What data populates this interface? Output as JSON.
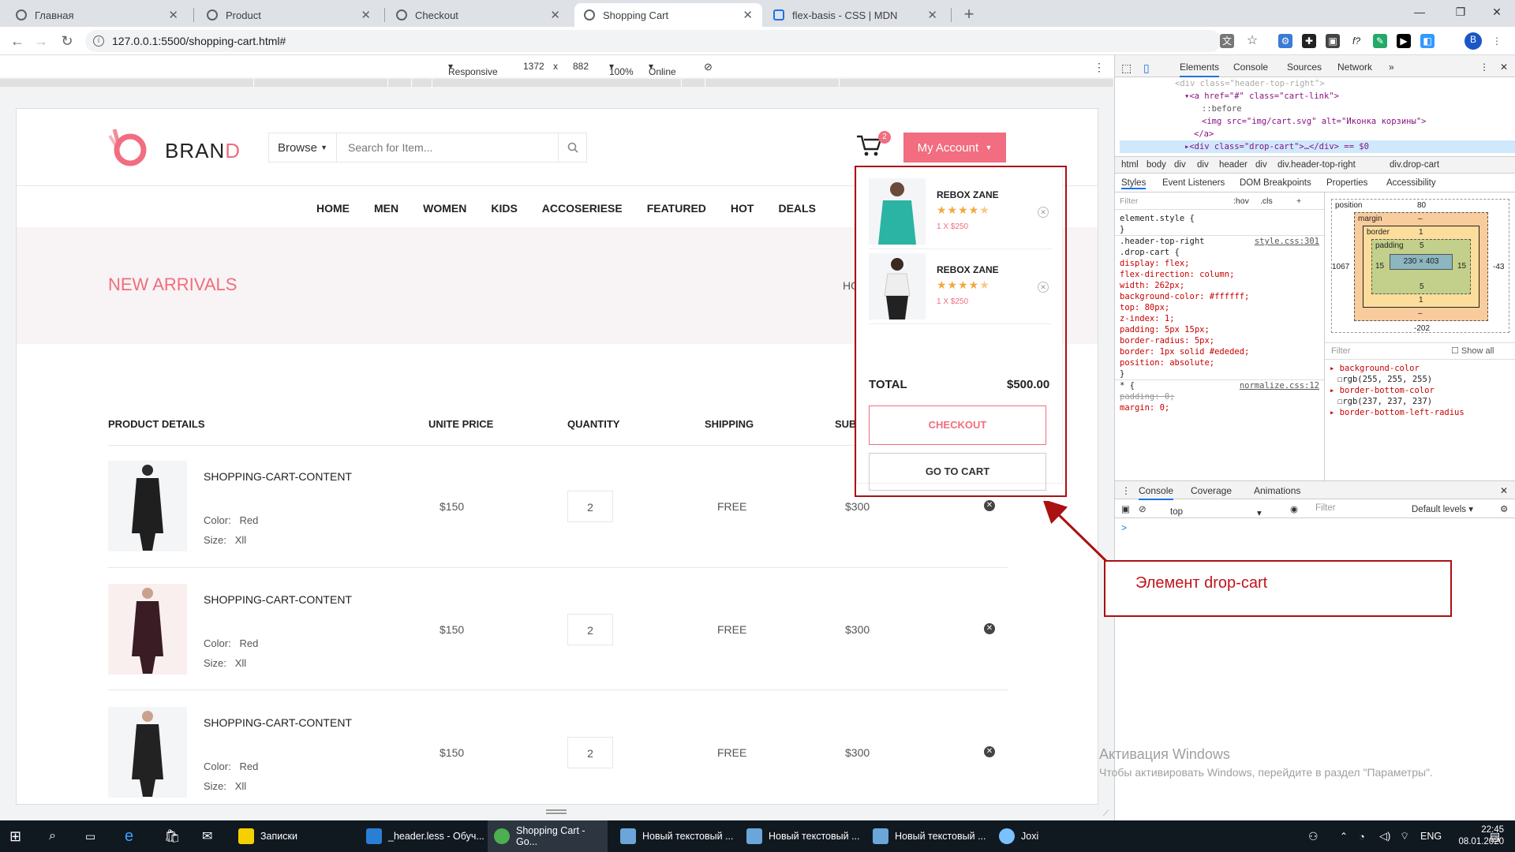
{
  "tabs": [
    {
      "title": "Главная"
    },
    {
      "title": "Product"
    },
    {
      "title": "Checkout"
    },
    {
      "title": "Shopping Cart"
    },
    {
      "title": "flex-basis - CSS | MDN"
    }
  ],
  "address": "127.0.0.1:5500/shopping-cart.html#",
  "device_toolbar": {
    "mode": "Responsive",
    "width": "1372",
    "x": "x",
    "height": "882",
    "zoom": "100%",
    "network": "Online"
  },
  "site": {
    "brand_prefix": "BRAN",
    "brand_suffix": "D",
    "browse": "Browse",
    "search_placeholder": "Search for Item...",
    "cart_count": "2",
    "account": "My Account",
    "nav": [
      "HOME",
      "MEN",
      "WOMEN",
      "KIDS",
      "ACCOSERIESE",
      "FEATURED",
      "HOT",
      "DEALS"
    ],
    "hero_title": "NEW ARRIVALS",
    "breadcrumb": "HO",
    "table_headers": [
      "PRODUCT DETAILS",
      "UNITE PRICE",
      "QUANTITY",
      "SHIPPING",
      "SUB"
    ],
    "rows": [
      {
        "name": "SHOPPING-CART-CONTENT",
        "color_label": "Color:",
        "color": "Red",
        "size_label": "Size:",
        "size": "Xll",
        "price": "$150",
        "qty": "2",
        "shipping": "FREE",
        "subtotal": "$300"
      },
      {
        "name": "SHOPPING-CART-CONTENT",
        "color_label": "Color:",
        "color": "Red",
        "size_label": "Size:",
        "size": "Xll",
        "price": "$150",
        "qty": "2",
        "shipping": "FREE",
        "subtotal": "$300"
      },
      {
        "name": "SHOPPING-CART-CONTENT",
        "color_label": "Color:",
        "color": "Red",
        "size_label": "Size:",
        "size": "Xll",
        "price": "$150",
        "qty": "2",
        "shipping": "FREE",
        "subtotal": "$300"
      }
    ],
    "drop_cart": {
      "items": [
        {
          "name": "REBOX ZANE",
          "price": "1 X $250",
          "rating": 4.5
        },
        {
          "name": "REBOX ZANE",
          "price": "1 X $250",
          "rating": 4.5
        }
      ],
      "total_label": "TOTAL",
      "total_value": "$500.00",
      "checkout": "CHECKOUT",
      "go_to_cart": "GO TO CART"
    }
  },
  "annotation": "Элемент drop-cart",
  "devtools": {
    "tabs": [
      "Elements",
      "Console",
      "Sources",
      "Network"
    ],
    "dom_lines": [
      "<div class=\"header-top-right\">",
      "▾<a href=\"#\" class=\"cart-link\">",
      "::before",
      "<img src=\"img/cart.svg\" alt=\"Иконка корзины\">",
      "</a>",
      "▸<div class=\"drop-cart\">…</div> == $0"
    ],
    "breadcrumb": [
      "html",
      "body",
      "div",
      "div",
      "header",
      "div",
      "div.header-top-right",
      "div.drop-cart"
    ],
    "subtabs": [
      "Styles",
      "Event Listeners",
      "DOM Breakpoints",
      "Properties",
      "Accessibility"
    ],
    "filter_placeholder": "Filter",
    "hov": ":hov",
    "cls": ".cls",
    "styles_lines": [
      "element.style {",
      "}",
      ".header-top-right",
      ".drop-cart {",
      "  display: flex;",
      "  flex-direction: column;",
      "  width: 262px;",
      "  background-color: #ffffff;",
      "  top: 80px;",
      "  z-index: 1;",
      "  padding: 5px 15px;",
      "  border-radius: 5px;",
      "  border: 1px solid #ededed;",
      "  position: absolute;",
      "}",
      "* {",
      "  padding: 0;",
      "  margin: 0;"
    ],
    "style_source": "style.css:301",
    "normalize_source": "normalize.css:12",
    "box_model": {
      "position_label": "position",
      "position_top": "80",
      "position_left": "1067",
      "position_right": "-43",
      "position_bottom": "-202",
      "margin_label": "margin",
      "margin_value": "–",
      "border_label": "border",
      "border_value": "1",
      "padding_label": "padding",
      "padding_value": "5",
      "padding_left": "15",
      "padding_right": "15",
      "content": "230 × 403"
    },
    "computed_filter": "Filter",
    "show_all": "Show all",
    "computed": [
      {
        "prop": "background-color",
        "value": "rgb(255, 255, 255)"
      },
      {
        "prop": "border-bottom-color",
        "value": "rgb(237, 237, 237)"
      },
      {
        "prop": "border-bottom-left-radius",
        "value": ""
      }
    ],
    "drawer_tabs": [
      "Console",
      "Coverage",
      "Animations"
    ],
    "console_context": "top",
    "console_filter": "Filter",
    "console_levels": "Default levels ▾",
    "console_prompt": ">"
  },
  "watermark": {
    "line1": "Активация Windows",
    "line2": "Чтобы активировать Windows, перейдите в раздел \"Параметры\"."
  },
  "taskbar": {
    "apps": [
      "Записки",
      "_header.less - Обуч...",
      "Shopping Cart - Go...",
      "Новый текстовый ...",
      "Новый текстовый ...",
      "Новый текстовый ...",
      "Joxi"
    ],
    "lang": "ENG",
    "time": "22:45",
    "date": "08.01.2020"
  },
  "colors": {
    "accent": "#f16d7f",
    "highlight": "#aa1111",
    "star": "#f3a73d"
  }
}
